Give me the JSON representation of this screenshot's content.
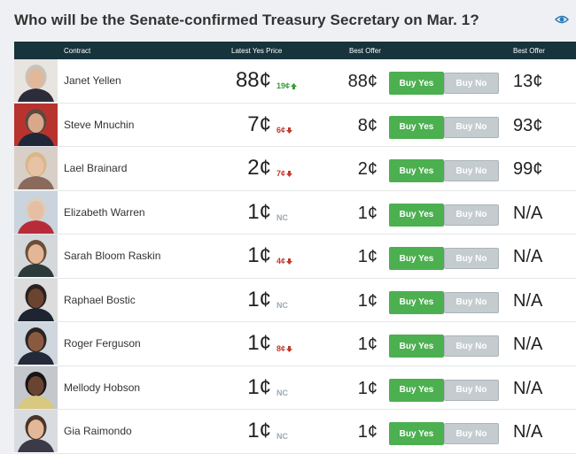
{
  "title": "Who will be the Senate-confirmed Treasury Secretary on Mar. 1?",
  "headers": {
    "contract": "Contract",
    "latest_yes_price": "Latest Yes Price",
    "best_offer_yes": "Best Offer",
    "best_offer_no": "Best Offer"
  },
  "buttons": {
    "yes": "Buy Yes",
    "no": "Buy No"
  },
  "rows": [
    {
      "name": "Janet Yellen",
      "price": "88¢",
      "change": "19¢",
      "dir": "up",
      "yes_offer": "88¢",
      "no_offer": "13¢",
      "photo": {
        "bg": "#e8e4e0",
        "skin": "#e2b89a",
        "hair": "#c9c2b8",
        "shirt": "#2c2c3a"
      }
    },
    {
      "name": "Steve Mnuchin",
      "price": "7¢",
      "change": "6¢",
      "dir": "down",
      "yes_offer": "8¢",
      "no_offer": "93¢",
      "photo": {
        "bg": "#b8332e",
        "skin": "#d9a88a",
        "hair": "#5a4a40",
        "shirt": "#1f2738"
      }
    },
    {
      "name": "Lael Brainard",
      "price": "2¢",
      "change": "7¢",
      "dir": "down",
      "yes_offer": "2¢",
      "no_offer": "99¢",
      "photo": {
        "bg": "#d8d0c8",
        "skin": "#e8c2a4",
        "hair": "#d9b78a",
        "shirt": "#8a6a5a"
      }
    },
    {
      "name": "Elizabeth Warren",
      "price": "1¢",
      "change": "NC",
      "dir": "nc",
      "yes_offer": "1¢",
      "no_offer": "N/A",
      "photo": {
        "bg": "#c9d4de",
        "skin": "#e6bfa2",
        "hair": "#d8cfc4",
        "shirt": "#b82c3a"
      }
    },
    {
      "name": "Sarah Bloom Raskin",
      "price": "1¢",
      "change": "4¢",
      "dir": "down",
      "yes_offer": "1¢",
      "no_offer": "N/A",
      "photo": {
        "bg": "#d5d8da",
        "skin": "#e2b696",
        "hair": "#6a4e38",
        "shirt": "#2c3a3a"
      }
    },
    {
      "name": "Raphael Bostic",
      "price": "1¢",
      "change": "NC",
      "dir": "nc",
      "yes_offer": "1¢",
      "no_offer": "N/A",
      "photo": {
        "bg": "#dcdcdc",
        "skin": "#6b4430",
        "hair": "#2a2020",
        "shirt": "#1e2432"
      }
    },
    {
      "name": "Roger Ferguson",
      "price": "1¢",
      "change": "8¢",
      "dir": "down",
      "yes_offer": "1¢",
      "no_offer": "N/A",
      "photo": {
        "bg": "#cfd6dd",
        "skin": "#8a5a40",
        "hair": "#2a2424",
        "shirt": "#242a3a"
      }
    },
    {
      "name": "Mellody Hobson",
      "price": "1¢",
      "change": "NC",
      "dir": "nc",
      "yes_offer": "1¢",
      "no_offer": "N/A",
      "photo": {
        "bg": "#c4c8cc",
        "skin": "#6a4432",
        "hair": "#1a1414",
        "shirt": "#d8c880"
      }
    },
    {
      "name": "Gia Raimondo",
      "price": "1¢",
      "change": "NC",
      "dir": "nc",
      "yes_offer": "1¢",
      "no_offer": "N/A",
      "photo": {
        "bg": "#d8dce0",
        "skin": "#e2b898",
        "hair": "#4a3428",
        "shirt": "#3a3a48"
      }
    }
  ],
  "colors": {
    "header_bg": "#17333c",
    "buy_yes": "#4caf50",
    "buy_no": "#c5ccd0",
    "up": "#3a9a3a",
    "down": "#c0392b",
    "nc": "#9aa9b2",
    "eye_icon": "#2a7ab8"
  }
}
